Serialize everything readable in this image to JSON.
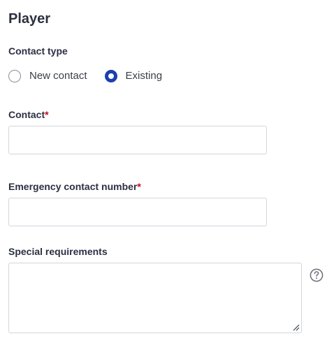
{
  "section": {
    "title": "Player"
  },
  "contact_type": {
    "label": "Contact type",
    "options": [
      {
        "label": "New contact",
        "selected": false
      },
      {
        "label": "Existing",
        "selected": true
      }
    ]
  },
  "contact": {
    "label": "Contact",
    "required_marker": "*",
    "value": ""
  },
  "emergency_contact_number": {
    "label": "Emergency contact number",
    "required_marker": "*",
    "value": ""
  },
  "special_requirements": {
    "label": "Special requirements",
    "value": "",
    "help_icon": "question-circle-icon"
  },
  "colors": {
    "text": "#2b3041",
    "required": "#d0021b",
    "radio_selected": "#1c3fb0",
    "input_border": "#d3d6dc"
  }
}
